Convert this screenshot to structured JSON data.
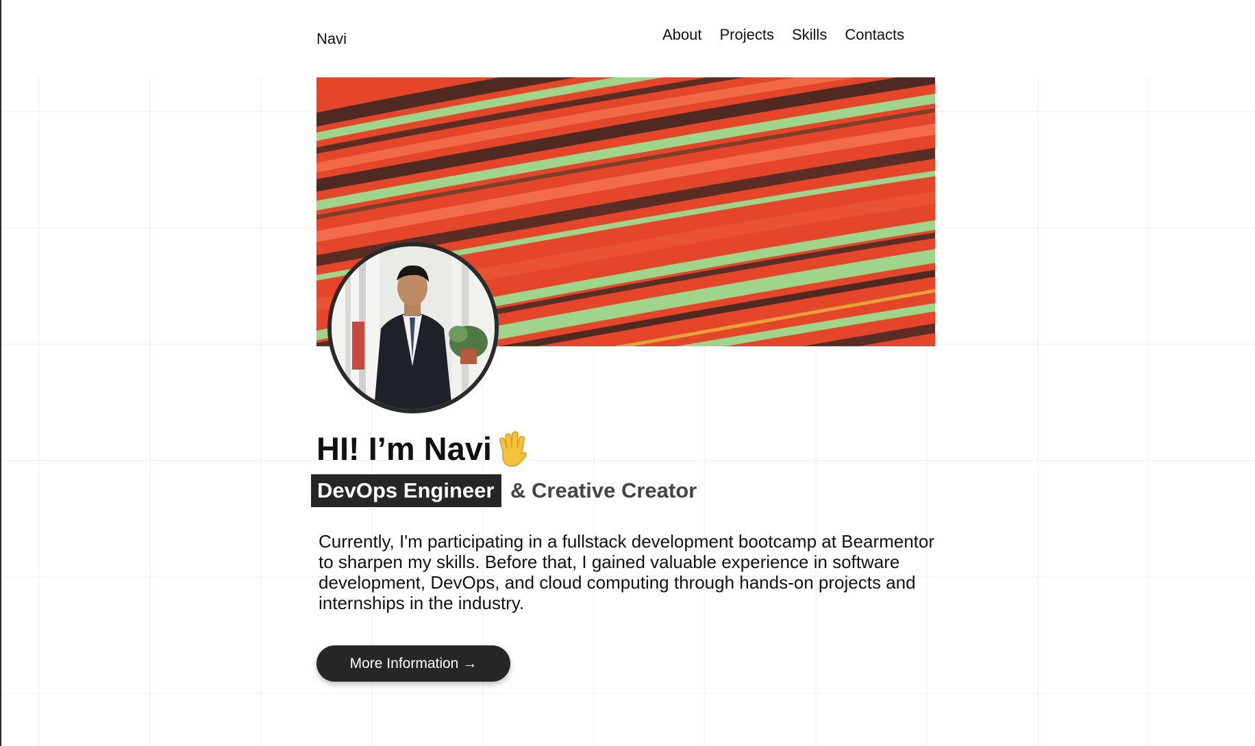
{
  "header": {
    "brand": "Navi",
    "nav": [
      {
        "label": "About"
      },
      {
        "label": "Projects"
      },
      {
        "label": "Skills"
      },
      {
        "label": "Contacts"
      }
    ]
  },
  "hero": {
    "greeting": "HI! I’m Navi",
    "wave_icon": "waving-hand-icon",
    "role_highlight": "DevOps Engineer",
    "role_suffix": "& Creative Creator",
    "bio": "Currently, I'm participating in a fullstack development bootcamp at Bearmentor to sharpen my skills. Before that, I gained valuable experience in software development, DevOps, and cloud computing through hands-on projects and internships in the industry.",
    "cta_label": "More Information",
    "cta_arrow": "→"
  },
  "colors": {
    "banner_orange": "#e5462a",
    "banner_green": "#9fd58a",
    "banner_dark": "#5a2e25",
    "dark_ui": "#262626"
  }
}
